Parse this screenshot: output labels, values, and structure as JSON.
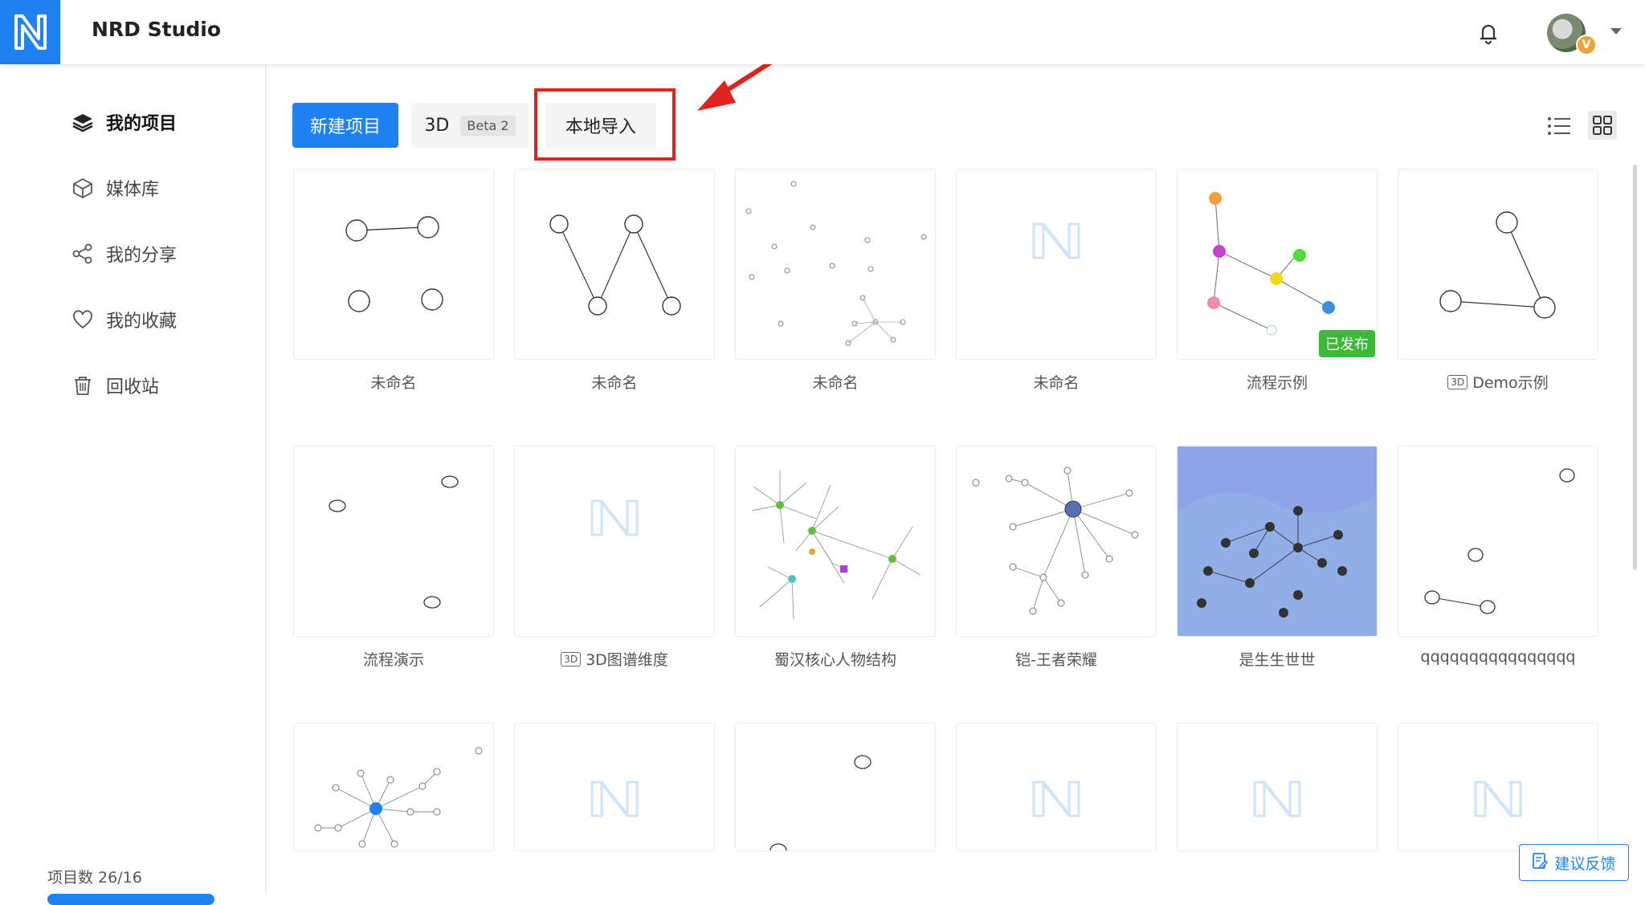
{
  "header": {
    "app_title": "NRD Studio",
    "avatar_badge": "V"
  },
  "sidebar": {
    "items": [
      {
        "label": "我的项目",
        "icon": "layers-icon",
        "active": true
      },
      {
        "label": "媒体库",
        "icon": "cube-icon"
      },
      {
        "label": "我的分享",
        "icon": "share-icon"
      },
      {
        "label": "我的收藏",
        "icon": "heart-icon"
      },
      {
        "label": "回收站",
        "icon": "trash-icon"
      }
    ],
    "quota": {
      "label": "项目数 26/16",
      "fill_fraction": 1.0
    }
  },
  "toolbar": {
    "new_project": "新建项目",
    "three_d": "3D",
    "beta": "Beta 2",
    "local_import": "本地导入"
  },
  "projects": [
    {
      "title": "未命名"
    },
    {
      "title": "未命名"
    },
    {
      "title": "未命名"
    },
    {
      "title": "未命名"
    },
    {
      "title": "流程示例",
      "badge": "已发布"
    },
    {
      "title": "Demo示例",
      "tag": "3D"
    },
    {
      "title": "流程演示"
    },
    {
      "title": "3D图谱维度",
      "tag": "3D"
    },
    {
      "title": "蜀汉核心人物结构"
    },
    {
      "title": "铠-王者荣耀"
    },
    {
      "title": "是生生世世"
    },
    {
      "title": "qqqqqqqqqqqqqqqq"
    }
  ],
  "feedback": {
    "label": "建议反馈"
  },
  "colors": {
    "accent": "#1e82f5",
    "published": "#3cb83a",
    "annotation": "#e0231c"
  }
}
